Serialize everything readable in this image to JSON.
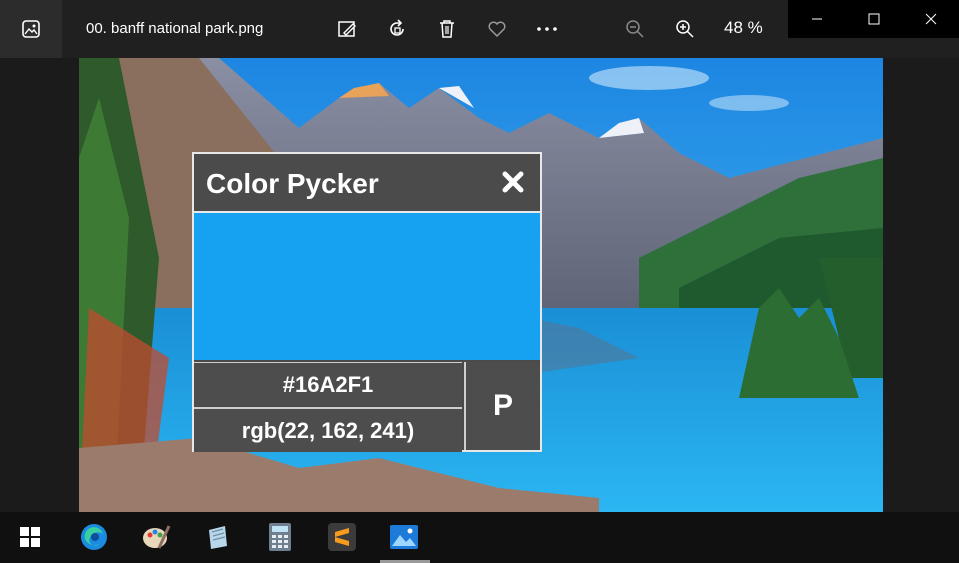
{
  "titlebar": {
    "file_name": "00. banff national park.png",
    "zoom": "48 %",
    "toolbar": [
      "edit-image-icon",
      "rotate-icon",
      "delete-icon",
      "favorite-icon",
      "more-icon",
      "zoom-out-icon",
      "zoom-in-icon"
    ]
  },
  "picker": {
    "title": "Color Pycker",
    "hex": "#16A2F1",
    "rgb": "rgb(22, 162, 241)",
    "pick_label": "P",
    "swatch_color": "#16A2F1"
  },
  "taskbar": {
    "items": [
      "start-icon",
      "edge-icon",
      "paint-icon",
      "notes-icon",
      "calculator-icon",
      "sublime-icon",
      "photos-icon"
    ]
  }
}
